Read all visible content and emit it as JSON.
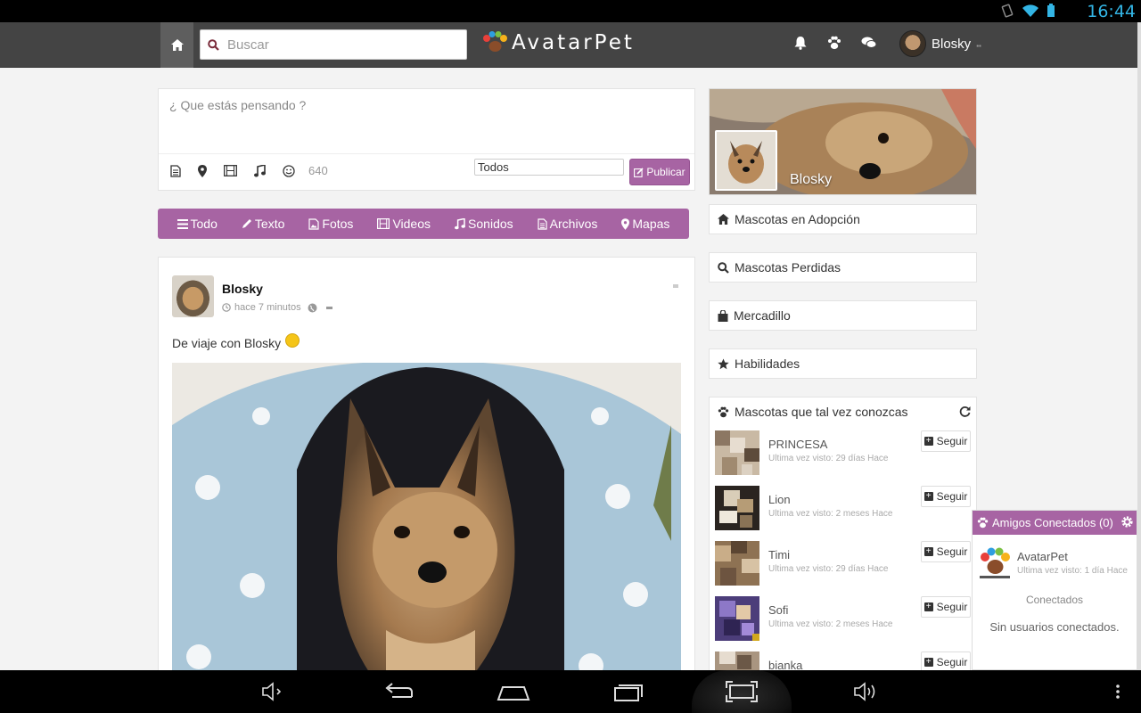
{
  "status_bar": {
    "time": "16:44"
  },
  "navbar": {
    "search_placeholder": "Buscar",
    "logo_text": "AvatarPet",
    "username": "Blosky"
  },
  "composer": {
    "placeholder": "¿ Que estás pensando ?",
    "char_count": "640",
    "privacy_value": "Todos",
    "publish_label": "Publicar"
  },
  "filters": [
    "Todo",
    "Texto",
    "Fotos",
    "Videos",
    "Sonidos",
    "Archivos",
    "Mapas"
  ],
  "post": {
    "author": "Blosky",
    "time": "hace 7 minutos",
    "text": "De viaje con Blosky"
  },
  "profile": {
    "name": "Blosky"
  },
  "side_links": [
    {
      "label": "Mascotas en Adopción",
      "icon": "home-icon"
    },
    {
      "label": "Mascotas Perdidas",
      "icon": "search-icon"
    },
    {
      "label": "Mercadillo",
      "icon": "shopping-bag-icon"
    },
    {
      "label": "Habilidades",
      "icon": "star-icon"
    }
  ],
  "suggestions": {
    "title": "Mascotas que tal vez conozcas",
    "follow_label": "Seguir",
    "items": [
      {
        "name": "PRINCESA",
        "last_seen": "Ultima vez visto: 29 días Hace"
      },
      {
        "name": "Lion",
        "last_seen": "Ultima vez visto: 2 meses Hace"
      },
      {
        "name": "Timi",
        "last_seen": "Ultima vez visto: 29 días Hace"
      },
      {
        "name": "Sofi",
        "last_seen": "Ultima vez visto: 2 meses Hace"
      },
      {
        "name": "bianka",
        "last_seen": ""
      }
    ]
  },
  "chat": {
    "title": "Amigos Conectados (0)",
    "contact_name": "AvatarPet",
    "contact_last_seen": "Ultima vez visto: 1 día Hace",
    "section_label": "Conectados",
    "empty_text": "Sin usuarios conectados."
  },
  "colors": {
    "accent": "#a764a3",
    "navbar": "#444444",
    "status_time": "#33b5e5"
  }
}
